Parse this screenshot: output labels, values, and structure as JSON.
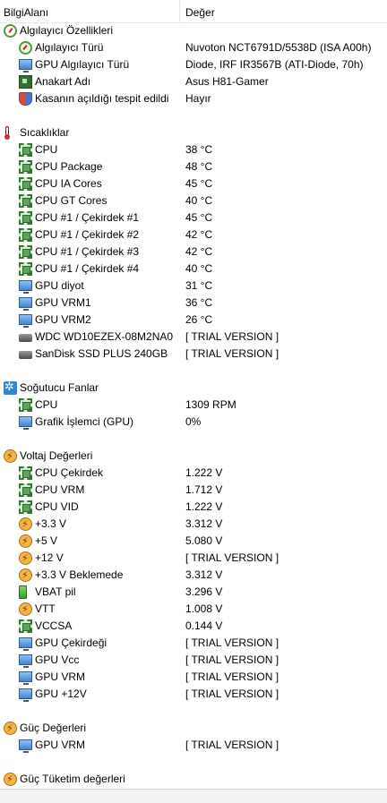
{
  "header": {
    "col1": "BilgiAlanı",
    "col2": "Değer"
  },
  "sections": [
    {
      "title": "Algılayıcı Özellikleri",
      "icon": "gauge-icon",
      "rows": [
        {
          "label": "Algılayıcı Türü",
          "value": "Nuvoton NCT6791D/5538D  (ISA A00h)",
          "icon": "sensor-gauge-icon"
        },
        {
          "label": "GPU Algılayıcı Türü",
          "value": "Diode, IRF IR3567B  (ATI-Diode, 70h)",
          "icon": "monitor-icon"
        },
        {
          "label": "Anakart Adı",
          "value": "Asus H81-Gamer",
          "icon": "motherboard-icon"
        },
        {
          "label": "Kasanın açıldığı tespit edildi",
          "value": "Hayır",
          "icon": "shield-icon"
        }
      ]
    },
    {
      "title": "Sıcaklıklar",
      "icon": "thermometer-icon",
      "rows": [
        {
          "label": "CPU",
          "value": "38 °C",
          "icon": "chip-icon"
        },
        {
          "label": "CPU Package",
          "value": "48 °C",
          "icon": "chip-icon"
        },
        {
          "label": "CPU IA Cores",
          "value": "45 °C",
          "icon": "chip-icon"
        },
        {
          "label": "CPU GT Cores",
          "value": "40 °C",
          "icon": "chip-icon"
        },
        {
          "label": "CPU #1 / Çekirdek #1",
          "value": "45 °C",
          "icon": "chip-icon"
        },
        {
          "label": "CPU #1 / Çekirdek #2",
          "value": "42 °C",
          "icon": "chip-icon"
        },
        {
          "label": "CPU #1 / Çekirdek #3",
          "value": "42 °C",
          "icon": "chip-icon"
        },
        {
          "label": "CPU #1 / Çekirdek #4",
          "value": "40 °C",
          "icon": "chip-icon"
        },
        {
          "label": "GPU diyot",
          "value": "31 °C",
          "icon": "monitor-icon"
        },
        {
          "label": "GPU VRM1",
          "value": "36 °C",
          "icon": "monitor-icon"
        },
        {
          "label": "GPU VRM2",
          "value": "26 °C",
          "icon": "monitor-icon"
        },
        {
          "label": "WDC WD10EZEX-08M2NA0",
          "value": "[ TRIAL VERSION ]",
          "icon": "disk-icon"
        },
        {
          "label": "SanDisk SSD PLUS 240GB",
          "value": "[ TRIAL VERSION ]",
          "icon": "disk-icon"
        }
      ]
    },
    {
      "title": "Soğutucu Fanlar",
      "icon": "fan-icon",
      "rows": [
        {
          "label": "CPU",
          "value": "1309 RPM",
          "icon": "chip-icon"
        },
        {
          "label": "Grafik İşlemci (GPU)",
          "value": "0%",
          "icon": "monitor-icon"
        }
      ]
    },
    {
      "title": "Voltaj Değerleri",
      "icon": "bolt-icon",
      "rows": [
        {
          "label": "CPU Çekirdek",
          "value": "1.222 V",
          "icon": "chip-icon"
        },
        {
          "label": "CPU VRM",
          "value": "1.712 V",
          "icon": "chip-icon"
        },
        {
          "label": "CPU VID",
          "value": "1.222 V",
          "icon": "chip-icon"
        },
        {
          "label": "+3.3 V",
          "value": "3.312 V",
          "icon": "bolt-icon"
        },
        {
          "label": "+5 V",
          "value": "5.080 V",
          "icon": "bolt-icon"
        },
        {
          "label": "+12 V",
          "value": "[ TRIAL VERSION ]",
          "icon": "bolt-icon"
        },
        {
          "label": "+3.3 V Beklemede",
          "value": "3.312 V",
          "icon": "bolt-icon"
        },
        {
          "label": "VBAT pil",
          "value": "3.296 V",
          "icon": "battery-icon"
        },
        {
          "label": "VTT",
          "value": "1.008 V",
          "icon": "bolt-icon"
        },
        {
          "label": "VCCSA",
          "value": "0.144 V",
          "icon": "chip-icon"
        },
        {
          "label": "GPU Çekirdeği",
          "value": "[ TRIAL VERSION ]",
          "icon": "monitor-icon"
        },
        {
          "label": "GPU Vcc",
          "value": "[ TRIAL VERSION ]",
          "icon": "monitor-icon"
        },
        {
          "label": "GPU VRM",
          "value": "[ TRIAL VERSION ]",
          "icon": "monitor-icon"
        },
        {
          "label": "GPU +12V",
          "value": "[ TRIAL VERSION ]",
          "icon": "monitor-icon"
        }
      ]
    },
    {
      "title": "Güç Değerleri",
      "icon": "bolt-icon",
      "rows": [
        {
          "label": "GPU VRM",
          "value": "[ TRIAL VERSION ]",
          "icon": "monitor-icon"
        }
      ]
    },
    {
      "title": "Güç Tüketim değerleri",
      "icon": "bolt-icon",
      "rows": []
    }
  ]
}
